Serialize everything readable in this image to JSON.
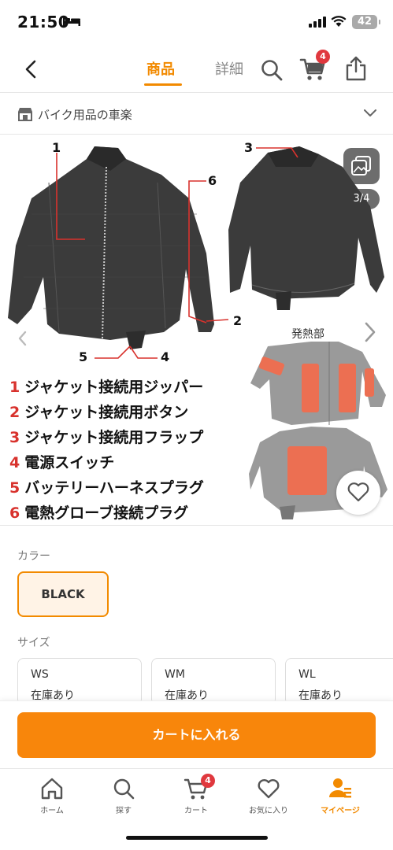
{
  "status_bar": {
    "time": "21:50",
    "battery": "42",
    "icons": [
      "bed-icon",
      "signal-icon",
      "wifi-icon",
      "battery-icon"
    ]
  },
  "header": {
    "tabs": [
      {
        "label": "商品",
        "active": true
      },
      {
        "label": "詳細",
        "active": false
      }
    ],
    "cart_count": "4",
    "icons": [
      "back-icon",
      "search-icon",
      "cart-icon",
      "share-icon"
    ]
  },
  "shop": {
    "name": "バイク用品の車楽",
    "icons": [
      "store-icon",
      "chevron-down-icon"
    ]
  },
  "gallery": {
    "counter": "3/4",
    "heat_label": "発熱部",
    "callouts": [
      "1",
      "2",
      "3",
      "4",
      "5",
      "6"
    ],
    "legend": [
      {
        "num": "1",
        "text": "ジャケット接続用ジッパー"
      },
      {
        "num": "2",
        "text": "ジャケット接続用ボタン"
      },
      {
        "num": "3",
        "text": "ジャケット接続用フラップ"
      },
      {
        "num": "4",
        "text": "電源スイッチ"
      },
      {
        "num": "5",
        "text": "バッテリーハーネスプラグ"
      },
      {
        "num": "6",
        "text": "電熱グローブ接続プラグ"
      }
    ]
  },
  "options": {
    "color_label": "カラー",
    "color_selected": "BLACK",
    "size_label": "サイズ",
    "sizes": [
      {
        "size": "WS",
        "stock": "在庫あり"
      },
      {
        "size": "WM",
        "stock": "在庫あり"
      },
      {
        "size": "WL",
        "stock": "在庫あり"
      }
    ]
  },
  "action": {
    "add_to_cart": "カートに入れる"
  },
  "tabbar": {
    "items": [
      {
        "label": "ホーム",
        "icon": "home-icon"
      },
      {
        "label": "探す",
        "icon": "search-icon"
      },
      {
        "label": "カート",
        "icon": "cart-icon",
        "badge": "4"
      },
      {
        "label": "お気に入り",
        "icon": "heart-icon"
      },
      {
        "label": "マイページ",
        "icon": "user-icon",
        "active": true
      }
    ]
  },
  "colors": {
    "accent": "#f28a00",
    "button": "#f8860b",
    "badge": "#e0383e",
    "legend_number": "#d8322d"
  }
}
